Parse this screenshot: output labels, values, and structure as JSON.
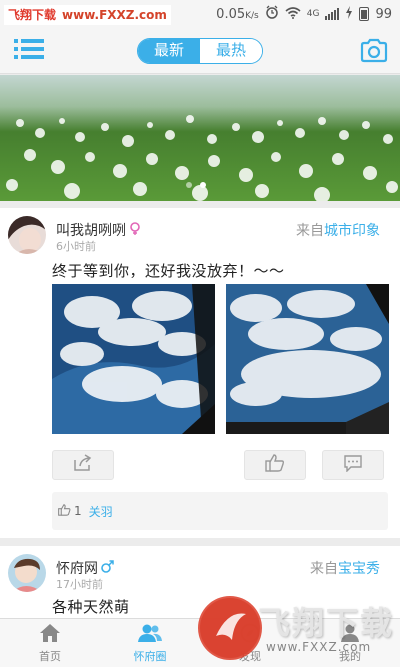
{
  "watermark_top": {
    "brand": "飞翔下载",
    "url": "www.FXXZ.com"
  },
  "status_bar": {
    "speed": "0.05",
    "speed_unit": "K/s",
    "network": "4G",
    "battery": "99",
    "colors": {
      "icon": "#555555"
    }
  },
  "top_nav": {
    "segments": [
      {
        "label": "最新",
        "active": true
      },
      {
        "label": "最热",
        "active": false
      }
    ],
    "icons": {
      "menu": "menu-icon",
      "camera": "camera-icon"
    },
    "accent": "#3bafe8"
  },
  "banner": {
    "slide_count": 2,
    "active_slide": 2
  },
  "posts": [
    {
      "username": "叫我胡咧咧",
      "gender": "female",
      "time": "6小时前",
      "source_prefix": "来自",
      "source_name": "城市印象",
      "content": "终于等到你，还好我没放弃！～～",
      "like_count": "1",
      "liker": "关羽"
    },
    {
      "username": "怀府网",
      "gender": "male",
      "time": "17小时前",
      "source_prefix": "来自",
      "source_name": "宝宝秀",
      "content": "各种天然萌"
    }
  ],
  "tabs": [
    {
      "label": "首页",
      "icon": "home-icon",
      "active": false
    },
    {
      "label": "怀府圈",
      "icon": "group-icon",
      "active": true
    },
    {
      "label": "发现",
      "icon": "discover-icon",
      "active": false
    },
    {
      "label": "我的",
      "icon": "profile-icon",
      "active": false
    }
  ],
  "watermark_bottom": {
    "title": "飞翔下载",
    "url": "www.FXXZ.com"
  }
}
